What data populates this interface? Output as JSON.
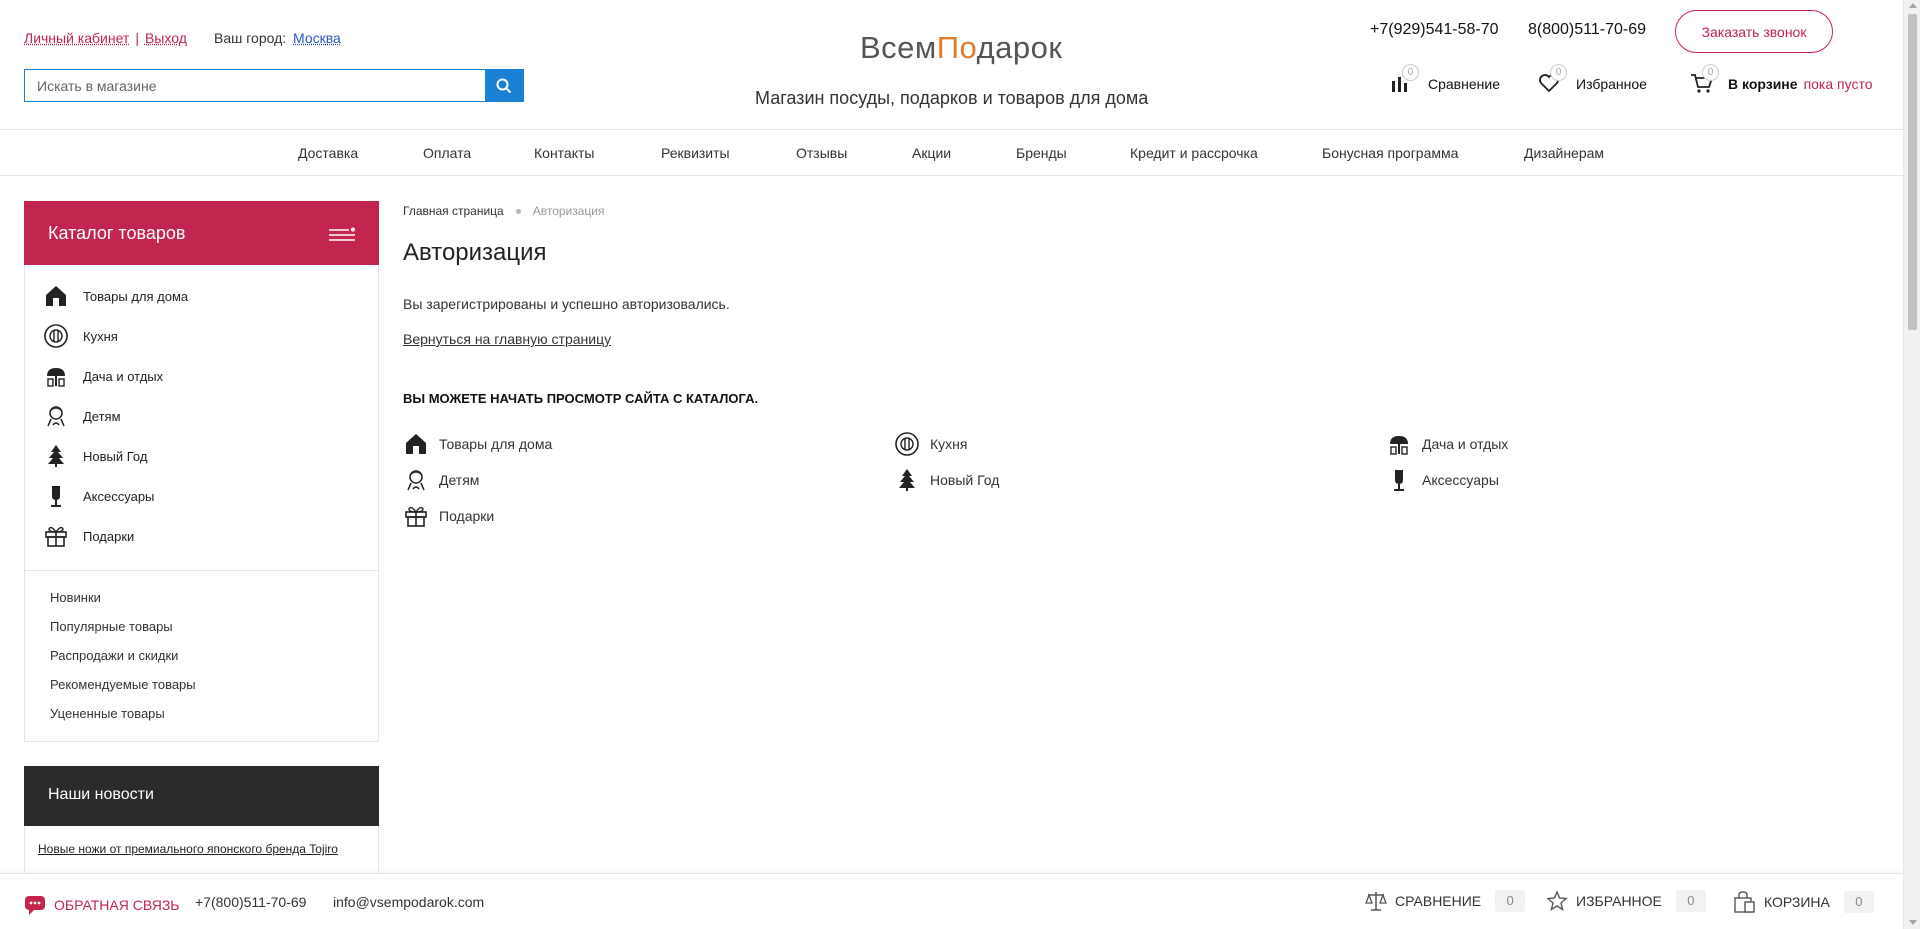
{
  "header": {
    "cabinet": "Личный кабинет",
    "separator": "|",
    "logout": "Выход",
    "city_label": "Ваш город:",
    "city": "Москва",
    "search_placeholder": "Искать в магазине",
    "logo_part1": "Всем",
    "logo_accent": "По",
    "logo_part2": "дарок",
    "tagline": "Магазин посуды, подарков и товаров для дома",
    "phone1": "+7(929)541-58-70",
    "phone2": "8(800)511-70-69",
    "callback": "Заказать звонок",
    "compare_label": "Сравнение",
    "compare_count": "0",
    "favorites_label": "Избранное",
    "favorites_count": "0",
    "cart_label": "В корзине",
    "cart_count": "0",
    "cart_status": "пока пусто"
  },
  "nav": [
    "Доставка",
    "Оплата",
    "Контакты",
    "Реквизиты",
    "Отзывы",
    "Акции",
    "Бренды",
    "Кредит и рассрочка",
    "Бонусная программа",
    "Дизайнерам"
  ],
  "sidebar": {
    "catalog_title": "Каталог товаров",
    "categories": [
      {
        "label": "Товары для дома",
        "icon": "house-icon"
      },
      {
        "label": "Кухня",
        "icon": "kitchen-icon"
      },
      {
        "label": "Дача и отдых",
        "icon": "tree-icon"
      },
      {
        "label": "Детям",
        "icon": "kid-icon"
      },
      {
        "label": "Новый Год",
        "icon": "christmas-tree-icon"
      },
      {
        "label": "Аксессуары",
        "icon": "accessory-icon"
      },
      {
        "label": "Подарки",
        "icon": "gift-icon"
      }
    ],
    "links": [
      "Новинки",
      "Популярные товары",
      "Распродажи и скидки",
      "Рекомендуемые товары",
      "Уцененные товары"
    ],
    "news_title": "Наши новости",
    "news_link": "Новые ножи от премиального японского бренда Tojiro"
  },
  "main": {
    "breadcrumb_home": "Главная страница",
    "breadcrumb_current": "Авторизация",
    "title": "Авторизация",
    "message": "Вы зарегистрированы и успешно авторизовались.",
    "back_link": "Вернуться на главную страницу",
    "catalog_heading": "ВЫ МОЖЕТЕ НАЧАТЬ ПРОСМОТР САЙТА С КАТАЛОГА.",
    "categories": [
      "Товары для дома",
      "Кухня",
      "Дача и отдых",
      "Детям",
      "Новый Год",
      "Аксессуары",
      "Подарки"
    ]
  },
  "footer": {
    "feedback": "ОБРАТНАЯ СВЯЗЬ",
    "phone": "+7(800)511-70-69",
    "email": "info@vsempodarok.com",
    "compare": "СРАВНЕНИЕ",
    "compare_count": "0",
    "favorites": "ИЗБРАННОЕ",
    "favorites_count": "0",
    "cart": "КОРЗИНА",
    "cart_count": "0"
  },
  "colors": {
    "accent": "#c2254d",
    "search_blue": "#1a80d6",
    "news_dark": "#2b2b2b",
    "logo_orange": "#e07b2b"
  }
}
